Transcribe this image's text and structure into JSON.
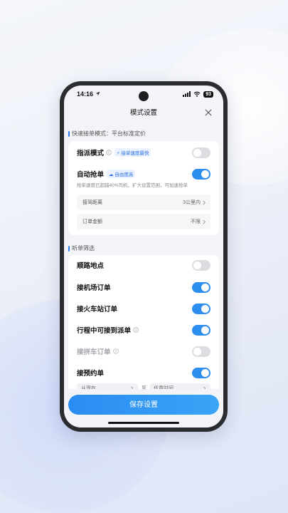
{
  "status_bar": {
    "time": "14:16",
    "battery": "93"
  },
  "header": {
    "title": "模式设置"
  },
  "section1": {
    "title": "快速接单模式：平台标准定价",
    "dispatch": {
      "label": "指派模式",
      "tag": "接单速度最快",
      "enabled": false
    },
    "auto_grab": {
      "label": "自动抢单",
      "tag": "自由度高",
      "enabled": true,
      "description": "抢单速度已超越40%司机，扩大设置范围，可加速抢单"
    },
    "pickup_distance": {
      "label": "接驾距离",
      "value": "3公里内"
    },
    "order_amount": {
      "label": "订单金额",
      "value": "不限"
    }
  },
  "section2": {
    "title": "听单筛选",
    "items": [
      {
        "label": "顺路地点",
        "enabled": false,
        "info": false,
        "dim": false
      },
      {
        "label": "接机场订单",
        "enabled": true,
        "info": false,
        "dim": false
      },
      {
        "label": "接火车站订单",
        "enabled": true,
        "info": false,
        "dim": false
      },
      {
        "label": "行程中可接到派单",
        "enabled": true,
        "info": true,
        "dim": false
      },
      {
        "label": "接拼车订单",
        "enabled": false,
        "info": true,
        "dim": true
      },
      {
        "label": "接预约单",
        "enabled": true,
        "info": false,
        "dim": false
      }
    ],
    "range_from": "从现在",
    "range_to_word": "至",
    "range_to": "任意时间"
  },
  "save_button": {
    "label": "保存设置"
  },
  "colors": {
    "accent": "#2d8ef0",
    "toggle_off": "#dcdde1"
  }
}
